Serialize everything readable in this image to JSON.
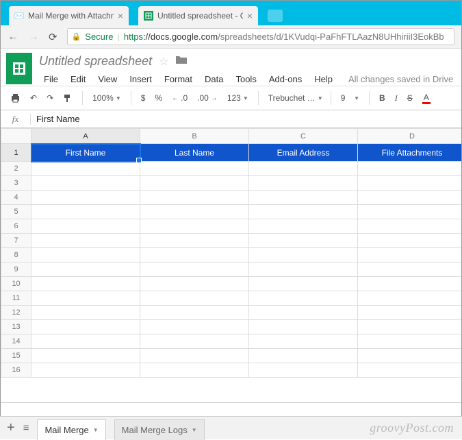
{
  "browser": {
    "tabs": [
      {
        "title": "Mail Merge with Attachm",
        "favicon": "📧"
      },
      {
        "title": "Untitled spreadsheet - G",
        "favicon": "sheets"
      }
    ],
    "secure_label": "Secure",
    "url_scheme": "https",
    "url_host": "://docs.google.com",
    "url_path": "/spreadsheets/d/1KVudqi-PaFhFTLAazN8UHhiriiI3EokBb"
  },
  "doc": {
    "title": "Untitled spreadsheet",
    "menus": [
      "File",
      "Edit",
      "View",
      "Insert",
      "Format",
      "Data",
      "Tools",
      "Add-ons",
      "Help"
    ],
    "save_status": "All changes saved in Drive"
  },
  "toolbar": {
    "zoom": "100%",
    "currency": "$",
    "percent": "%",
    "dec_dec": ".0",
    "dec_inc": ".00",
    "numfmt": "123",
    "font": "Trebuchet …",
    "size": "9",
    "bold": "B",
    "italic": "I",
    "strike": "S",
    "textcolor": "A"
  },
  "formula_bar": {
    "fx": "fx",
    "value": "First Name"
  },
  "columns": [
    "A",
    "B",
    "C",
    "D"
  ],
  "rows": [
    "1",
    "2",
    "3",
    "4",
    "5",
    "6",
    "7",
    "8",
    "9",
    "10",
    "11",
    "12",
    "13",
    "14",
    "15",
    "16"
  ],
  "headers": {
    "A": "First Name",
    "B": "Last Name",
    "C": "Email Address",
    "D": "File Attachments"
  },
  "sheet_tabs": {
    "active": "Mail Merge",
    "inactive": "Mail Merge Logs"
  },
  "watermark": "groovyPost.com"
}
